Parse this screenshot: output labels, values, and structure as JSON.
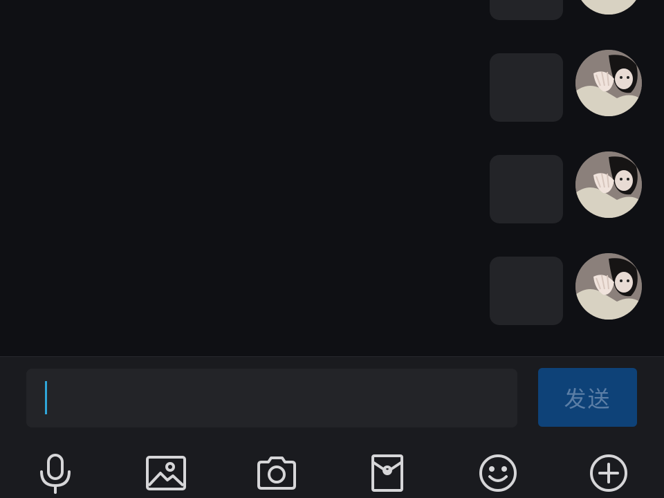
{
  "messages": [
    {
      "id": 1,
      "side": "right",
      "bubble_text": ""
    },
    {
      "id": 2,
      "side": "right",
      "bubble_text": ""
    },
    {
      "id": 3,
      "side": "right",
      "bubble_text": ""
    },
    {
      "id": 4,
      "side": "right",
      "bubble_text": ""
    }
  ],
  "composer": {
    "input_value": "",
    "send_label": "发送"
  },
  "toolbar": {
    "items": [
      {
        "name": "microphone-icon"
      },
      {
        "name": "image-icon"
      },
      {
        "name": "camera-icon"
      },
      {
        "name": "red-packet-icon"
      },
      {
        "name": "emoji-icon"
      },
      {
        "name": "plus-icon"
      }
    ]
  },
  "colors": {
    "background": "#0f1014",
    "bubble": "#232428",
    "composer": "#1a1b1f",
    "send_button": "#0e4278",
    "send_text": "#5b7ea6",
    "caret": "#2fa6d9",
    "icon": "#d6d6d8"
  }
}
